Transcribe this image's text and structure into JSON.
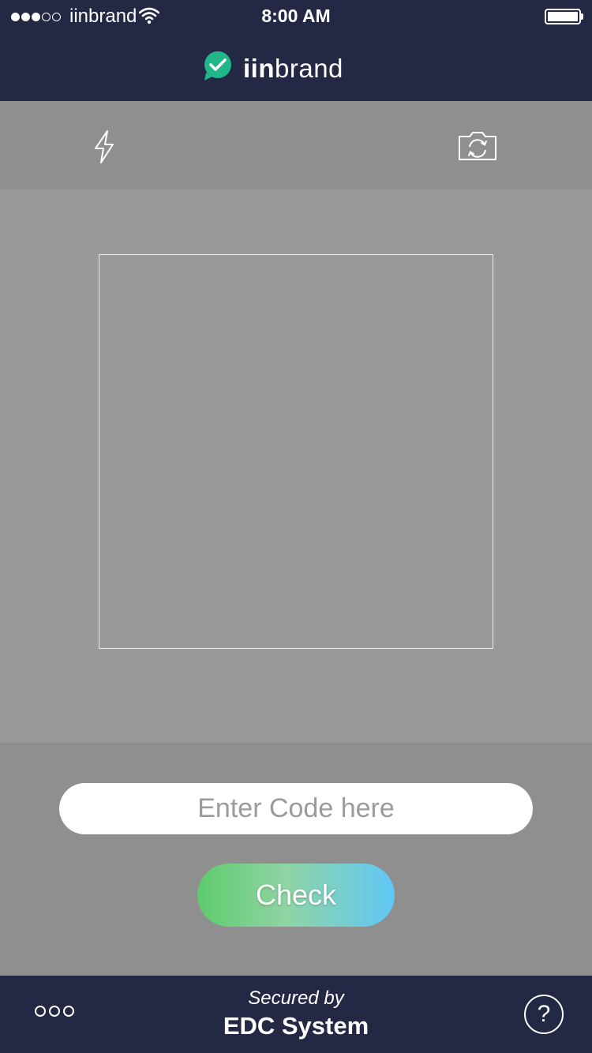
{
  "status_bar": {
    "carrier": "iinbrand",
    "time": "8:00 AM",
    "signal_bars": 3,
    "signal_total": 5
  },
  "header": {
    "logo_bold": "iin",
    "logo_light": "brand",
    "logo_icon": "checkmark-badge-icon",
    "accent_color": "#1fb68a"
  },
  "toolbar": {
    "flash_icon": "flash-icon",
    "camera_icon": "camera-switch-icon"
  },
  "scan": {
    "frame": "scan-frame"
  },
  "form": {
    "code_value": "",
    "code_placeholder": "Enter Code here",
    "check_label": "Check"
  },
  "footer": {
    "secured_label": "Secured by",
    "secured_system": "EDC System",
    "more_icon": "more-icon",
    "help_label": "?"
  },
  "colors": {
    "nav_background": "#232945",
    "toolbar_background": "#8f8f8f",
    "viewfinder_background": "#999999",
    "button_gradient_start": "#5fcb6c",
    "button_gradient_end": "#60c8f6"
  }
}
